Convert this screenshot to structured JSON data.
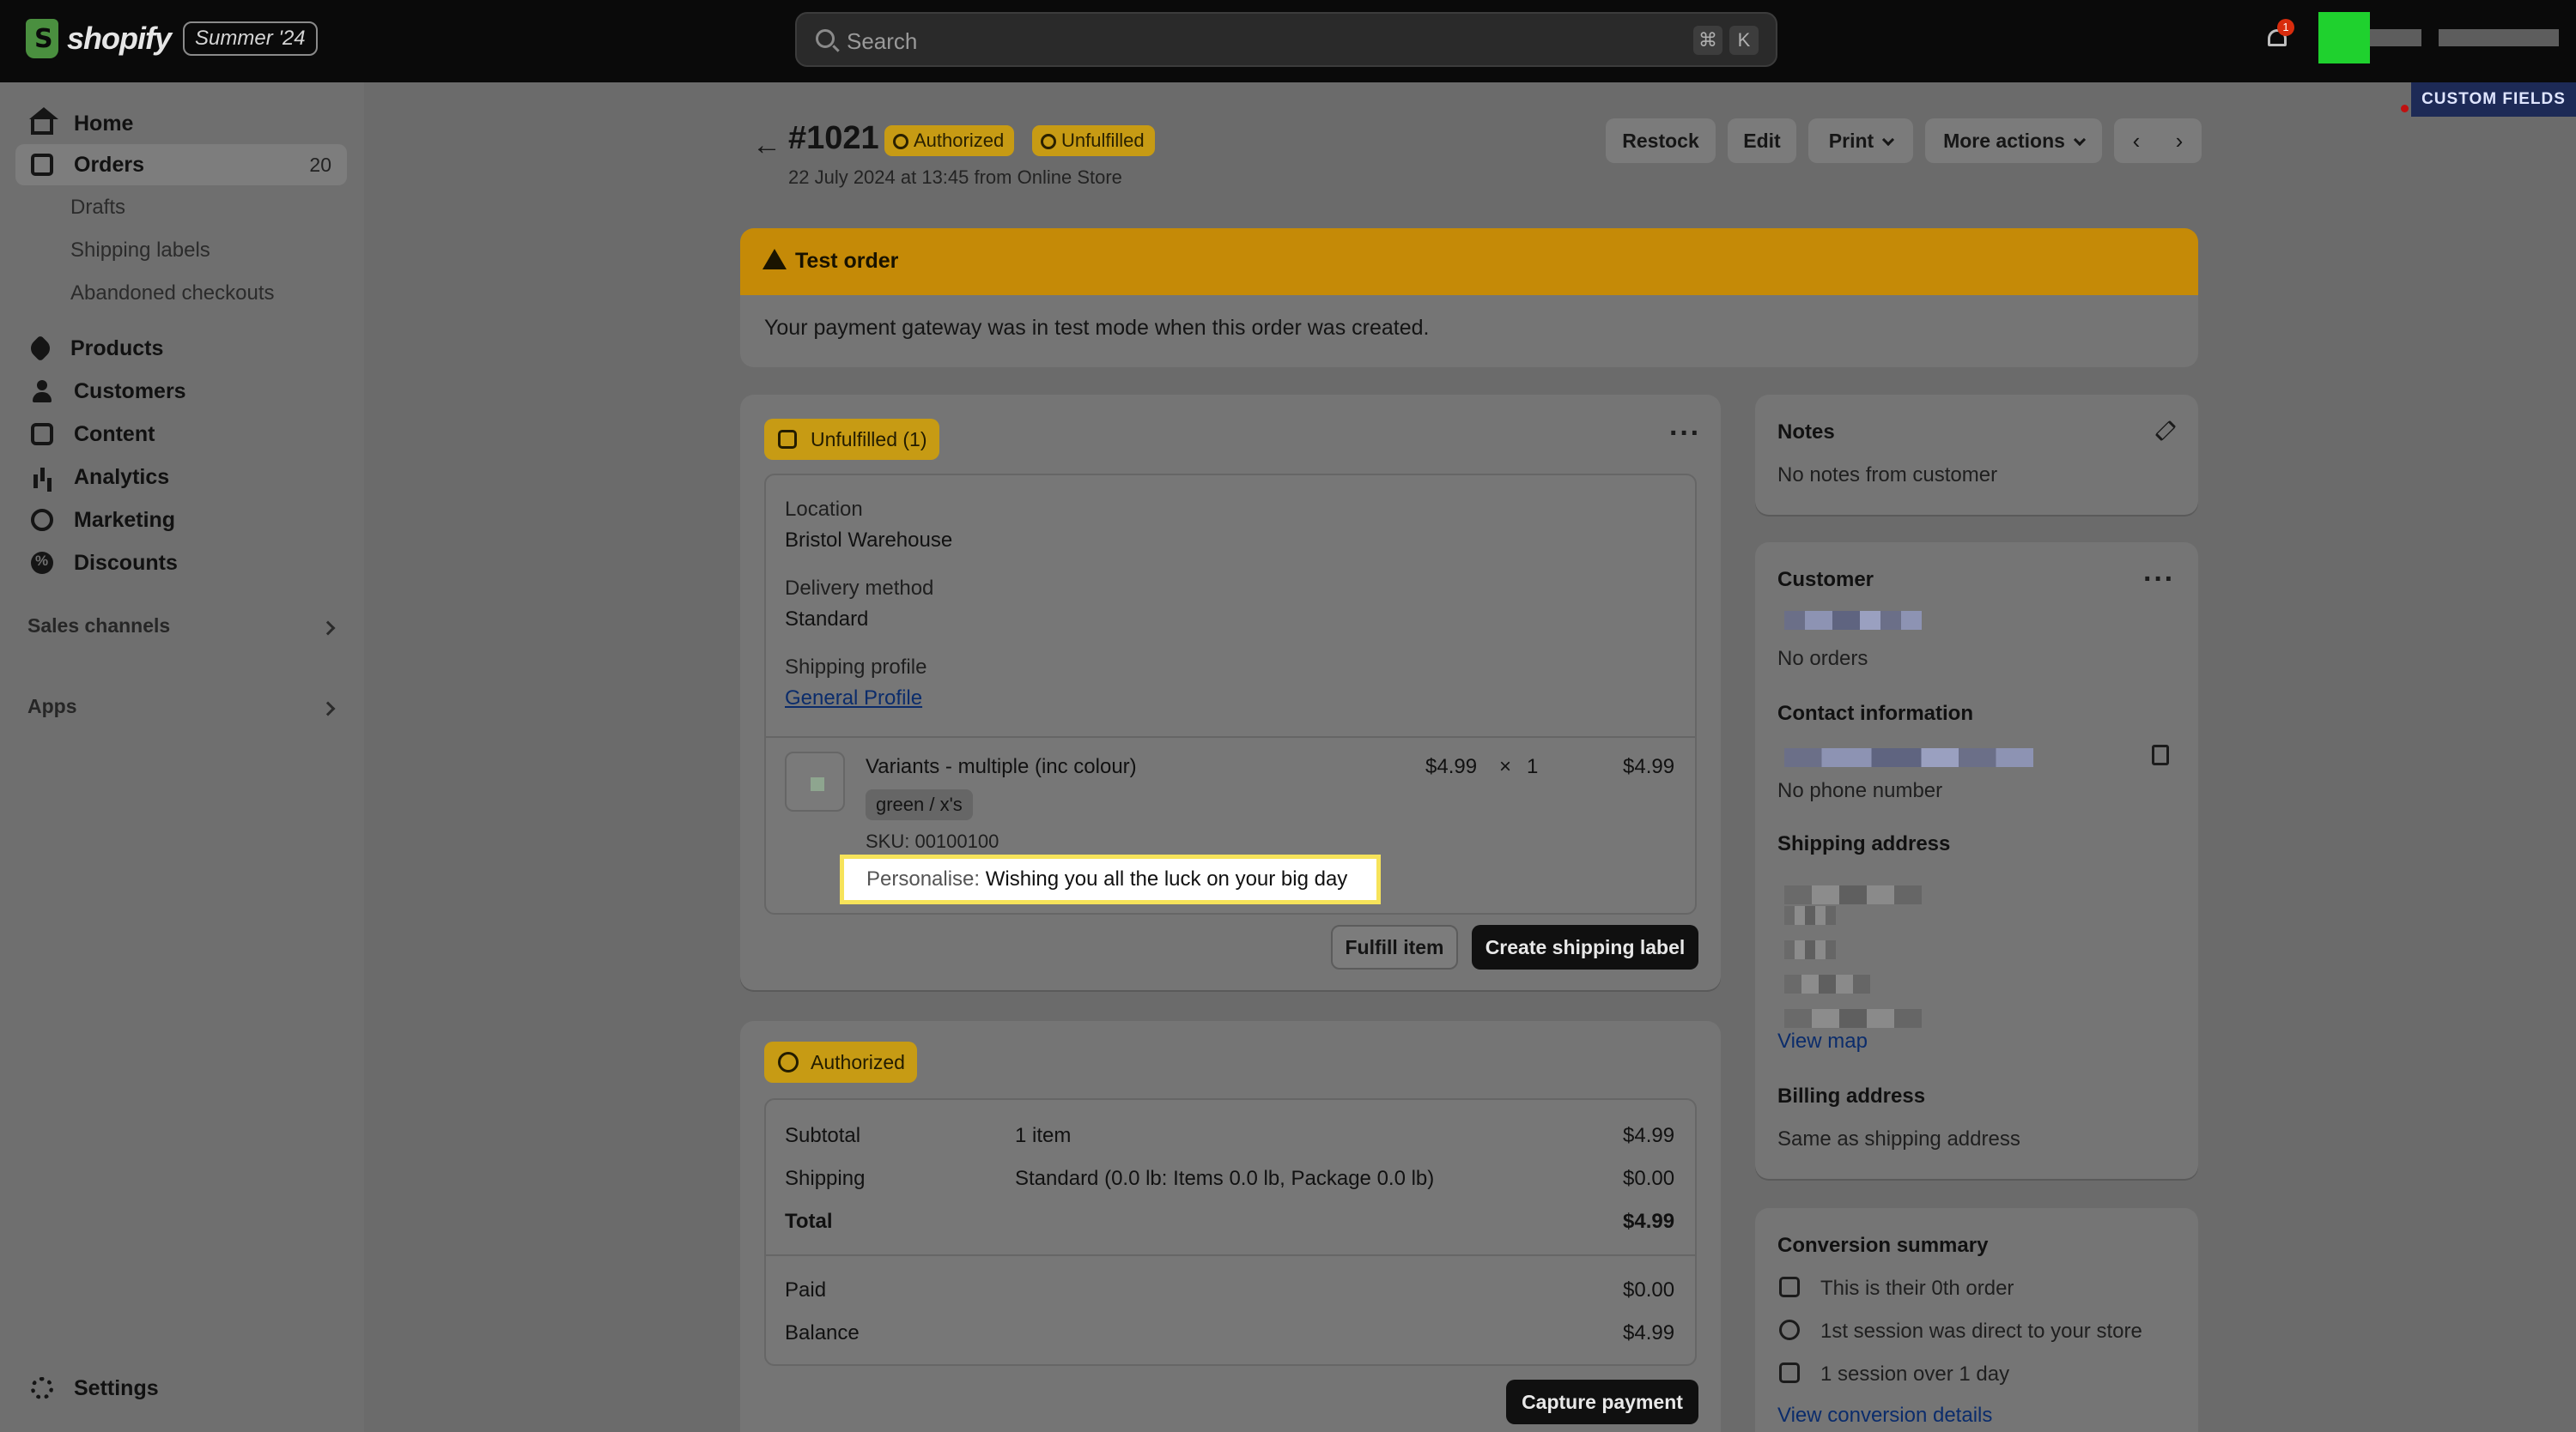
{
  "topbar": {
    "logo_text": "shopify",
    "edition_badge": "Summer '24",
    "search_placeholder": "Search",
    "shortcut_keys": [
      "⌘",
      "K"
    ],
    "notification_count": "1"
  },
  "sidebar": {
    "items": [
      {
        "label": "Home",
        "icon": "home-icon"
      },
      {
        "label": "Orders",
        "icon": "orders-icon",
        "count": "20"
      },
      {
        "label": "Products",
        "icon": "products-icon"
      },
      {
        "label": "Customers",
        "icon": "customers-icon"
      },
      {
        "label": "Content",
        "icon": "content-icon"
      },
      {
        "label": "Analytics",
        "icon": "analytics-icon"
      },
      {
        "label": "Marketing",
        "icon": "marketing-icon"
      },
      {
        "label": "Discounts",
        "icon": "discounts-icon"
      }
    ],
    "order_subitems": [
      "Drafts",
      "Shipping labels",
      "Abandoned checkouts"
    ],
    "sales_channels": "Sales channels",
    "apps": "Apps",
    "settings": "Settings"
  },
  "header": {
    "order_number": "#1021",
    "status_payment": "Authorized",
    "status_fulfillment": "Unfulfilled",
    "subtitle": "22 July 2024 at 13:45 from Online Store",
    "buttons": {
      "restock": "Restock",
      "edit": "Edit",
      "print": "Print",
      "more": "More actions"
    },
    "prev": "‹",
    "next": "›",
    "custom_fields": "CUSTOM FIELDS"
  },
  "test_order": {
    "title": "Test order",
    "message": "Your payment gateway was in test mode when this order was created."
  },
  "fulfillment": {
    "badge": "Unfulfilled (1)",
    "location_label": "Location",
    "location_value": "Bristol Warehouse",
    "delivery_label": "Delivery method",
    "delivery_value": "Standard",
    "profile_label": "Shipping profile",
    "profile_value": "General Profile",
    "item": {
      "name": "Variants - multiple (inc colour)",
      "variant": "green / x's",
      "sku": "SKU: 00100100",
      "price": "$4.99",
      "times": "×",
      "qty": "1",
      "total": "$4.99",
      "personalise_label": "Personalise:",
      "personalise_value": "Wishing you all the luck on your big day"
    },
    "fulfill_button": "Fulfill item",
    "shipping_label_button": "Create shipping label"
  },
  "payment": {
    "badge": "Authorized",
    "rows": [
      {
        "label": "Subtotal",
        "detail": "1 item",
        "amount": "$4.99"
      },
      {
        "label": "Shipping",
        "detail": "Standard (0.0 lb: Items 0.0 lb, Package 0.0 lb)",
        "amount": "$0.00"
      },
      {
        "label": "Total",
        "detail": "",
        "amount": "$4.99"
      }
    ],
    "paid_label": "Paid",
    "paid_amount": "$0.00",
    "balance_label": "Balance",
    "balance_amount": "$4.99",
    "capture_button": "Capture payment"
  },
  "notes": {
    "title": "Notes",
    "body": "No notes from customer"
  },
  "customer": {
    "title": "Customer",
    "orders": "No orders",
    "contact_title": "Contact information",
    "no_phone": "No phone number",
    "shipping_title": "Shipping address",
    "view_map": "View map",
    "billing_title": "Billing address",
    "billing_value": "Same as shipping address"
  },
  "conversion": {
    "title": "Conversion summary",
    "lines": [
      "This is their 0th order",
      "1st session was direct to your store",
      "1 session over 1 day"
    ],
    "link": "View conversion details"
  }
}
